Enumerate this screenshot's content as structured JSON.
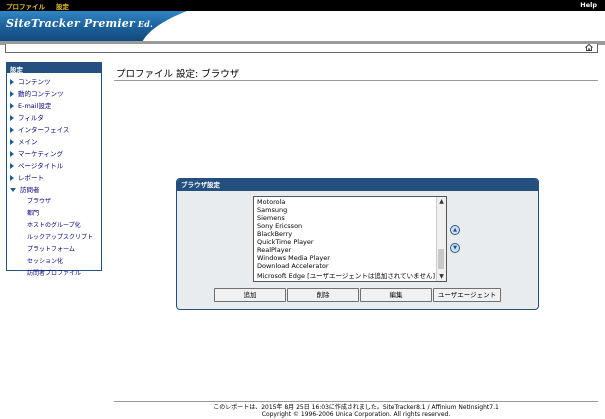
{
  "topbar": {
    "menu_profile": "プロファイル",
    "menu_settings": "設定",
    "help": "Help",
    "colors": {
      "bg": "#000000",
      "menu_text": "#f0c020",
      "help_text": "#ffffff"
    }
  },
  "banner": {
    "title_main": "SiteTracker Premier",
    "title_ed": " Ed."
  },
  "toolbar": {
    "home_icon": "home-icon"
  },
  "sidebar": {
    "header": "設定",
    "items": [
      {
        "label": "コンテンツ"
      },
      {
        "label": "動的コンテンツ"
      },
      {
        "label": "E-mail設定"
      },
      {
        "label": "フィルタ"
      },
      {
        "label": "インターフェイス"
      },
      {
        "label": "メイン"
      },
      {
        "label": "マーケティング"
      },
      {
        "label": "ページタイトル"
      },
      {
        "label": "レポート"
      },
      {
        "label": "訪問者"
      }
    ],
    "subitems": [
      {
        "label": "ブラウザ"
      },
      {
        "label": "都門"
      },
      {
        "label": "ホストのグループ化"
      },
      {
        "label": "ルックアップスクリプト"
      },
      {
        "label": "プラットフォーム"
      },
      {
        "label": "セッション化"
      },
      {
        "label": "訪問者プロファイル"
      }
    ]
  },
  "main": {
    "page_title": "プロファイル 設定: ブラウザ"
  },
  "panel": {
    "title": "ブラウザ設定",
    "list": [
      "Motorola",
      "Samsung",
      "Siemens",
      "Sony Ericsson",
      "BlackBerry",
      "QuickTime Player",
      "RealPlayer",
      "Windows Media Player",
      "Download Accelerator",
      "Microsoft Edge [ユーザエージェントは追加されていません]"
    ],
    "buttons": {
      "add": "追加",
      "delete": "削除",
      "edit": "編集",
      "user_agent": "ユーザエージェント"
    },
    "move_up_icon": "up-arrow-icon",
    "move_down_icon": "down-arrow-icon"
  },
  "footer": {
    "line1": "このレポートは、2015年 8月 25日 16:03に作成されました。SiteTracker8.1 / Affinium NetInsight7.1",
    "line2": "Copyright © 1996-2006 Unica Corporation. All rights reserved."
  }
}
